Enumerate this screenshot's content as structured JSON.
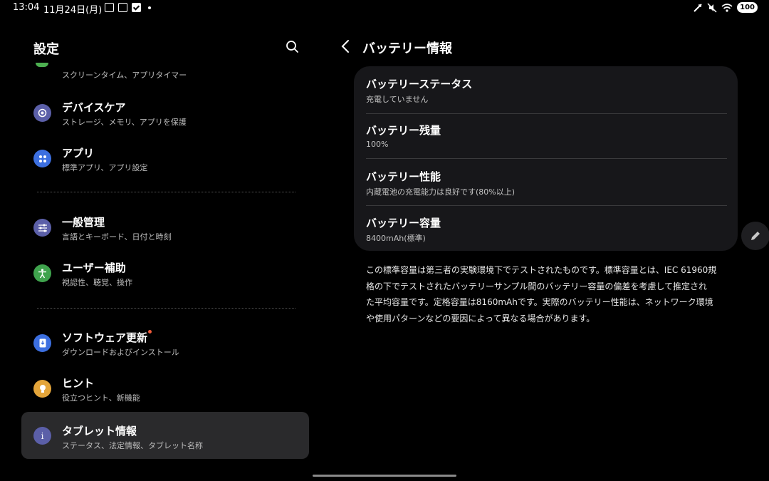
{
  "status_bar": {
    "time": "13:04",
    "date": "11月24日(月)",
    "battery": "100"
  },
  "left_panel": {
    "title": "設定",
    "partial_item_sub": "スクリーンタイム、アプリタイマー",
    "items": [
      {
        "title": "デバイスケア",
        "sub": "ストレージ、メモリ、アプリを保護",
        "icon": "device-care-icon",
        "color": "#5b5fa8"
      },
      {
        "title": "アプリ",
        "sub": "標準アプリ、アプリ設定",
        "icon": "apps-icon",
        "color": "#3c6fe0"
      },
      {
        "title": "一般管理",
        "sub": "言語とキーボード、日付と時刻",
        "icon": "sliders-icon",
        "color": "#5b5fa8"
      },
      {
        "title": "ユーザー補助",
        "sub": "視認性、聴覚、操作",
        "icon": "accessibility-icon",
        "color": "#3fa34d"
      },
      {
        "title": "ソフトウェア更新",
        "sub": "ダウンロードおよびインストール",
        "icon": "software-update-icon",
        "color": "#3c6fe0"
      },
      {
        "title": "ヒント",
        "sub": "役立つヒント、新機能",
        "icon": "lightbulb-icon",
        "color": "#e4a53a"
      },
      {
        "title": "タブレット情報",
        "sub": "ステータス、法定情報、タブレット名称",
        "icon": "info-icon",
        "color": "#5b5fa8"
      }
    ]
  },
  "right_panel": {
    "title": "バッテリー情報",
    "rows": [
      {
        "title": "バッテリーステータス",
        "value": "充電していません"
      },
      {
        "title": "バッテリー残量",
        "value": "100%"
      },
      {
        "title": "バッテリー性能",
        "value": "内蔵電池の充電能力は良好です(80%以上)"
      },
      {
        "title": "バッテリー容量",
        "value": "8400mAh(標準)"
      }
    ],
    "note_lines": [
      "この標準容量は第三者の実験環境下でテストされたものです。標準容量とは、IEC 61960規",
      "格の下でテストされたバッテリーサンプル間のバッテリー容量の偏差を考慮して推定され",
      "た平均容量です。定格容量は8160mAhです。実際のバッテリー性能は、ネットワーク環境",
      "や使用パターンなどの要因によって異なる場合があります。"
    ]
  }
}
